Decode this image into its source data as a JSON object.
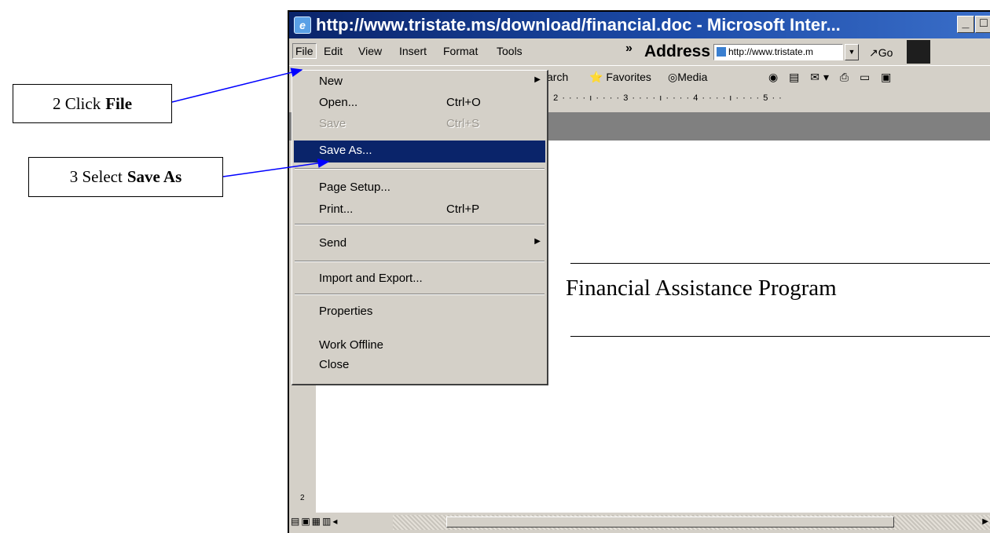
{
  "callouts": {
    "step2": {
      "prefix": "2 Click",
      "bold": "File"
    },
    "step3": {
      "prefix": "3 Select",
      "bold": "Save As"
    }
  },
  "window": {
    "title": "http://www.tristate.ms/download/financial.doc - Microsoft Inter...",
    "icon": "ie-icon",
    "controls": {
      "minimize": "_",
      "maximize": "□"
    }
  },
  "menubar": {
    "items": [
      "File",
      "Edit",
      "View",
      "Insert",
      "Format",
      "Tools"
    ],
    "chevron": "»",
    "address_label": "Address",
    "address_value": "http://www.tristate.m",
    "go_label": "Go"
  },
  "toolbar": {
    "search_fragment": "arch",
    "favorites": "Favorites",
    "media": "Media"
  },
  "ruler": {
    "text": "· · · 2 · · · · ı · · · · 3 · · · · ı · · · · 4 · · · · ı · · · · 5 · ·"
  },
  "document": {
    "heading": "Financial Assistance Program",
    "vruler_mark": "2"
  },
  "file_menu": {
    "items": [
      {
        "label": "New",
        "shortcut": "",
        "submenu": true,
        "disabled": false,
        "highlight": false
      },
      {
        "label": "Open...",
        "shortcut": "Ctrl+O",
        "submenu": false,
        "disabled": false,
        "highlight": false
      },
      {
        "label": "Save",
        "shortcut": "Ctrl+S",
        "submenu": false,
        "disabled": true,
        "highlight": false
      },
      {
        "label": "Save As...",
        "shortcut": "",
        "submenu": false,
        "disabled": false,
        "highlight": true
      },
      {
        "label": "Page Setup...",
        "shortcut": "",
        "submenu": false,
        "disabled": false,
        "highlight": false
      },
      {
        "label": "Print...",
        "shortcut": "Ctrl+P",
        "submenu": false,
        "disabled": false,
        "highlight": false
      },
      {
        "label": "Send",
        "shortcut": "",
        "submenu": true,
        "disabled": false,
        "highlight": false
      },
      {
        "label": "Import and Export...",
        "shortcut": "",
        "submenu": false,
        "disabled": false,
        "highlight": false
      },
      {
        "label": "Properties",
        "shortcut": "",
        "submenu": false,
        "disabled": false,
        "highlight": false
      },
      {
        "label": "Work Offline",
        "shortcut": "",
        "submenu": false,
        "disabled": false,
        "highlight": false
      },
      {
        "label": "Close",
        "shortcut": "",
        "submenu": false,
        "disabled": false,
        "highlight": false
      }
    ]
  },
  "colors": {
    "titlebar": "#0a246a",
    "highlight": "#0a246a",
    "arrow": "#0000ff",
    "chrome": "#d4d0c8"
  }
}
